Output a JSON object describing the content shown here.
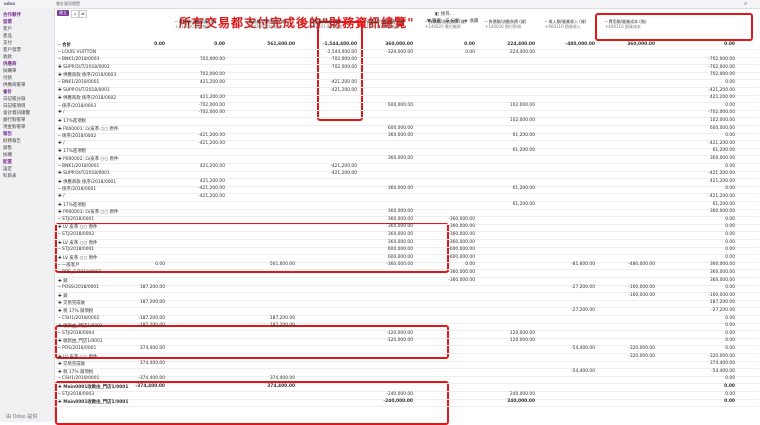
{
  "app": {
    "logo": "odoo",
    "breadcrumb": "會計資訊總覽",
    "banner": "所有交易都支付完成後的\"財務資訊總覽\"",
    "new_label": "建立",
    "filter_label": "篩選",
    "group_label": "分組",
    "fav_label": "收藏",
    "search_label": "搜尋..."
  },
  "sidebar": {
    "items": [
      {
        "label": "合作夥伴",
        "section": true
      },
      {
        "label": "發票",
        "section": true
      },
      {
        "label": "客戶",
        "section": false
      },
      {
        "label": "產品",
        "section": false
      },
      {
        "label": "支付",
        "section": false
      },
      {
        "label": "客戶發票",
        "section": false
      },
      {
        "label": "收款",
        "section": false
      },
      {
        "label": "供應商",
        "section": true
      },
      {
        "label": "採購單",
        "section": false
      },
      {
        "label": "付款",
        "section": false
      },
      {
        "label": "供應商帳單",
        "section": false
      },
      {
        "label": "會計",
        "section": true
      },
      {
        "label": "日記帳分錄",
        "section": false
      },
      {
        "label": "日記帳項目",
        "section": false
      },
      {
        "label": "會計資訊總覽",
        "section": false
      },
      {
        "label": "銀行對帳單",
        "section": false
      },
      {
        "label": "現金對帳單",
        "section": false
      },
      {
        "label": "報告",
        "section": true
      },
      {
        "label": "財務報告",
        "section": false
      },
      {
        "label": "銷售",
        "section": false
      },
      {
        "label": "採購",
        "section": false
      },
      {
        "label": "配置",
        "section": true
      },
      {
        "label": "設定",
        "section": false
      },
      {
        "label": "科目表",
        "section": false
      }
    ],
    "footer": "由 Odoo 提供"
  },
  "grid": {
    "columns": [
      "─ 資產類/流動資產 (借)",
      "─ 負債類/流動負債 (貸)",
      "─ 資產類/現金 (借)",
      "─ 資產類/流動資產 (借)",
      "─ 負債類/流動負債 (貸)",
      "─ 負債類/流動負債 (貸)",
      "─ 收入類/營業收入 (貸)",
      "─ 費用類/營業成本 (借)"
    ],
    "subcolumns": [
      "+112000 應收帳款",
      "+220200 應付帳款",
      "+100101 庫存現金",
      "+140010 應收帳款",
      "+140020 應付帳款",
      "+140030 預付款項",
      "+600110 銷貨收入",
      "+640110 銷貨成本"
    ],
    "rows": [
      {
        "label": "─ 合計",
        "bold": true,
        "vals": [
          "0.00",
          "0.00",
          "561,600.00",
          "-1,544,400.00",
          "360,000.00",
          "0.00",
          "224,400.00",
          "-480,000.00",
          "360,000.00",
          "0.00"
        ]
      },
      {
        "label": "─ LOUIS VUITTON",
        "bold": false,
        "vals": [
          "",
          "",
          "",
          "-1,544,400.00",
          "-329,000.00",
          "0.00",
          "224,400.00",
          "",
          "",
          ""
        ]
      },
      {
        "label": "─ BNK1/2018/0003",
        "bold": false,
        "vals": [
          "",
          "702,000.00",
          "",
          "-702,000.00",
          "",
          "",
          "",
          "",
          "",
          "-702,000.00"
        ]
      },
      {
        "label": "  ✚ SUPP.OUT/2018/0002",
        "bold": false,
        "vals": [
          "",
          "",
          "",
          "-702,000.00",
          "",
          "",
          "",
          "",
          "",
          "-702,000.00"
        ]
      },
      {
        "label": "  ✚ 供應商款 係序/2018/0003",
        "bold": false,
        "vals": [
          "",
          "702,000.00",
          "",
          "",
          "",
          "",
          "",
          "",
          "",
          "702,000.00"
        ]
      },
      {
        "label": "─ BNK1/2018/0001",
        "bold": false,
        "vals": [
          "",
          "421,200.00",
          "",
          "-421,200.00",
          "",
          "",
          "",
          "",
          "",
          "0.00"
        ]
      },
      {
        "label": "  ✚ SUPP.OUT/2018/0001",
        "bold": false,
        "vals": [
          "",
          "",
          "",
          "-421,200.00",
          "",
          "",
          "",
          "",
          "",
          "-421,200.00"
        ]
      },
      {
        "label": "  ✚ 供應商款 係序/2018/0002",
        "bold": false,
        "vals": [
          "",
          "421,200.00",
          "",
          "",
          "",
          "",
          "",
          "",
          "",
          "421,200.00"
        ]
      },
      {
        "label": "─ 係序/2018/0003",
        "bold": false,
        "vals": [
          "",
          "-702,000.00",
          "",
          "",
          "600,000.00",
          "",
          "102,000.00",
          "",
          "",
          "0.00"
        ]
      },
      {
        "label": "  ✚ /",
        "bold": false,
        "vals": [
          "",
          "-702,000.00",
          "",
          "",
          "",
          "",
          "",
          "",
          "",
          "-702,000.00"
        ]
      },
      {
        "label": "  ✚ 17%進項稅",
        "bold": false,
        "vals": [
          "",
          "",
          "",
          "",
          "",
          "",
          "102,000.00",
          "",
          "",
          "102,000.00"
        ]
      },
      {
        "label": "  ✚ P000001: LV皮革 ○○ 原件",
        "bold": false,
        "vals": [
          "",
          "",
          "",
          "",
          "600,000.00",
          "",
          "",
          "",
          "",
          "600,000.00"
        ]
      },
      {
        "label": "─ 係序/2018/0002",
        "bold": false,
        "vals": [
          "",
          "-421,200.00",
          "",
          "",
          "360,000.00",
          "",
          "61,200.00",
          "",
          "",
          "0.00"
        ]
      },
      {
        "label": "  ✚ /",
        "bold": false,
        "vals": [
          "",
          "-421,200.00",
          "",
          "",
          "",
          "",
          "",
          "",
          "",
          "-421,200.00"
        ]
      },
      {
        "label": "  ✚ 17%進項稅",
        "bold": false,
        "vals": [
          "",
          "",
          "",
          "",
          "",
          "",
          "61,200.00",
          "",
          "",
          "61,200.00"
        ]
      },
      {
        "label": "  ✚ P000002: LV皮革 ○○ 原件",
        "bold": false,
        "vals": [
          "",
          "",
          "",
          "",
          "360,000.00",
          "",
          "",
          "",
          "",
          "360,000.00"
        ]
      },
      {
        "label": "─ BNK1/2018/0001",
        "bold": false,
        "vals": [
          "",
          "421,200.00",
          "",
          "-421,200.00",
          "",
          "",
          "",
          "",
          "",
          "0.00"
        ]
      },
      {
        "label": "  ✚ SUPP.OUT/2018/0001",
        "bold": false,
        "vals": [
          "",
          "",
          "",
          "-421,200.00",
          "",
          "",
          "",
          "",
          "",
          "-421,200.00"
        ]
      },
      {
        "label": "  ✚ 供應商款 係序/2018/0001",
        "bold": false,
        "vals": [
          "",
          "421,200.00",
          "",
          "",
          "",
          "",
          "",
          "",
          "",
          "421,200.00"
        ]
      },
      {
        "label": "─ 係序/2018/0001",
        "bold": false,
        "vals": [
          "",
          "-421,200.00",
          "",
          "",
          "360,000.00",
          "",
          "61,200.00",
          "",
          "",
          "0.00"
        ]
      },
      {
        "label": "  ✚ /",
        "bold": false,
        "vals": [
          "",
          "-421,200.00",
          "",
          "",
          "",
          "",
          "",
          "",
          "",
          "-421,200.00"
        ]
      },
      {
        "label": "  ✚ 17%進項稅",
        "bold": false,
        "vals": [
          "",
          "",
          "",
          "",
          "",
          "",
          "61,200.00",
          "",
          "",
          "61,200.00"
        ]
      },
      {
        "label": "  ✚ P000003: LV皮革 ○○ 原件",
        "bold": false,
        "vals": [
          "",
          "",
          "",
          "",
          "360,000.00",
          "",
          "",
          "",
          "",
          "360,000.00"
        ]
      },
      {
        "label": "─ STJ/2018/0001",
        "bold": false,
        "vals": [
          "",
          "",
          "",
          "",
          "360,000.00",
          "-360,000.00",
          "",
          "",
          "",
          "0.00"
        ]
      },
      {
        "label": "  ✚ LV 皮革 ○○ 原件",
        "bold": false,
        "vals": [
          "",
          "",
          "",
          "",
          "360,000.00",
          "-360,000.00",
          "",
          "",
          "",
          "0.00"
        ]
      },
      {
        "label": "─ STJ/2018/0002",
        "bold": false,
        "vals": [
          "",
          "",
          "",
          "",
          "360,000.00",
          "-360,000.00",
          "",
          "",
          "",
          "0.00"
        ]
      },
      {
        "label": "  ✚ LV 皮革 ○○ 原件",
        "bold": false,
        "vals": [
          "",
          "",
          "",
          "",
          "360,000.00",
          "-360,000.00",
          "",
          "",
          "",
          "0.00"
        ]
      },
      {
        "label": "─ STJ/2018/0001",
        "bold": false,
        "vals": [
          "",
          "",
          "",
          "",
          "600,000.00",
          "-600,000.00",
          "",
          "",
          "",
          "0.00"
        ]
      },
      {
        "label": "  ✚ LV 皮革 ○○ 原件",
        "bold": false,
        "vals": [
          "",
          "",
          "",
          "",
          "600,000.00",
          "-600,000.00",
          "",
          "",
          "",
          "0.00"
        ]
      },
      {
        "label": "─ 一般客戶",
        "bold": false,
        "vals": [
          "0.00",
          "",
          "561,600.00",
          "",
          "-360,000.00",
          "0.00",
          "",
          "-81,600.00",
          "-480,000.00",
          "360,000.00"
        ]
      },
      {
        "label": "─ POS_C/2018/0001",
        "bold": false,
        "vals": [
          "",
          "",
          "",
          "",
          "",
          "-360,000.00",
          "",
          "",
          "",
          "360,000.00"
        ]
      },
      {
        "label": "  ✚ 銷",
        "bold": false,
        "vals": [
          "",
          "",
          "",
          "",
          "",
          "-360,000.00",
          "",
          "",
          "",
          "360,000.00"
        ]
      },
      {
        "label": "─ POSS/2018/0001",
        "bold": false,
        "vals": [
          "187,200.00",
          "",
          "",
          "",
          "",
          "",
          "",
          "-27,200.00",
          "-160,000.00",
          "0.00"
        ]
      },
      {
        "label": "  ✚ 銷",
        "bold": false,
        "vals": [
          "",
          "",
          "",
          "",
          "",
          "",
          "",
          "",
          "-160,000.00",
          "-160,000.00"
        ]
      },
      {
        "label": "  ✚ 交易完成後",
        "bold": false,
        "vals": [
          "187,200.00",
          "",
          "",
          "",
          "",
          "",
          "",
          "",
          "",
          "187,200.00"
        ]
      },
      {
        "label": "  ✚ 稅 17% 銷項稅",
        "bold": false,
        "vals": [
          "",
          "",
          "",
          "",
          "",
          "",
          "",
          "-27,200.00",
          "",
          "-27,200.00"
        ]
      },
      {
        "label": "─ CSH1/2018/0002",
        "bold": false,
        "vals": [
          "-187,200.00",
          "",
          "187,200.00",
          "",
          "",
          "",
          "",
          "",
          "",
          "0.00"
        ]
      },
      {
        "label": "  ✚ 收款由_門店1/0001",
        "bold": false,
        "vals": [
          "-187,200.00",
          "",
          "187,200.00",
          "",
          "",
          "",
          "",
          "",
          "",
          "0.00"
        ]
      },
      {
        "label": "─ STJ/2018/0004",
        "bold": false,
        "vals": [
          "",
          "",
          "",
          "",
          "-120,000.00",
          "",
          "120,000.00",
          "",
          "",
          "0.00"
        ]
      },
      {
        "label": "  ✚ 收款由_門店1/0001",
        "bold": false,
        "vals": [
          "",
          "",
          "",
          "",
          "-120,000.00",
          "",
          "120,000.00",
          "",
          "",
          "0.00"
        ]
      },
      {
        "label": "─ POS/2018/0001",
        "bold": false,
        "vals": [
          "374,400.00",
          "",
          "",
          "",
          "",
          "",
          "",
          "-54,400.00",
          "-320,000.00",
          "0.00"
        ]
      },
      {
        "label": "  ✚ LV 皮革 ○○ 原件",
        "bold": false,
        "vals": [
          "",
          "",
          "",
          "",
          "",
          "",
          "",
          "",
          "-320,000.00",
          "-320,000.00"
        ]
      },
      {
        "label": "  ✚ 交易完成後",
        "bold": false,
        "vals": [
          "374,400.00",
          "",
          "",
          "",
          "",
          "",
          "",
          "",
          "",
          "374,400.00"
        ]
      },
      {
        "label": "  ✚ 稅 17% 銷項稅",
        "bold": false,
        "vals": [
          "",
          "",
          "",
          "",
          "",
          "",
          "",
          "-54,400.00",
          "",
          "-54,400.00"
        ]
      },
      {
        "label": "─ CSH1/2018/0001",
        "bold": false,
        "vals": [
          "-374,400.00",
          "",
          "374,400.00",
          "",
          "",
          "",
          "",
          "",
          "",
          "0.00"
        ]
      },
      {
        "label": "  ✚ Main0001收款由_門店1/0001",
        "bold": true,
        "vals": [
          "-374,400.00",
          "",
          "374,400.00",
          "",
          "",
          "",
          "",
          "",
          "",
          "0.00"
        ]
      },
      {
        "label": "─ STJ/2018/0003",
        "bold": false,
        "vals": [
          "",
          "",
          "",
          "",
          "-240,000.00",
          "",
          "240,000.00",
          "",
          "",
          "0.00"
        ]
      },
      {
        "label": "  ✚ Main0001收款由_門店1/0001",
        "bold": true,
        "vals": [
          "",
          "",
          "",
          "",
          "-240,000.00",
          "",
          "240,000.00",
          "",
          "",
          "0.00"
        ]
      }
    ]
  },
  "colors": {
    "accent": "#7c3a9b",
    "annotation": "#e01818"
  }
}
